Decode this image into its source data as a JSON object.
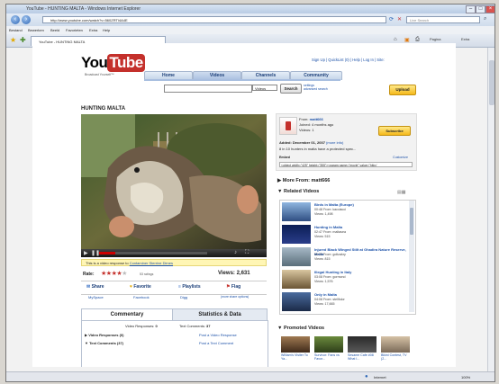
{
  "browser": {
    "title": "YouTube - HUNTING MALTA - Windows Internet Explorer",
    "url": "http://www.youtube.com/watch?v=560ZRTl4A4E",
    "search_placeholder": "Live Search",
    "menus": [
      "Bestand",
      "Bewerken",
      "Beeld",
      "Favorieten",
      "Extra",
      "Help"
    ],
    "tab_label": "YouTube - HUNTING MALTA",
    "tools": [
      "Pagina",
      "Extra"
    ],
    "status_zone": "Internet",
    "zoom": "100%"
  },
  "youtube": {
    "logo_you": "You",
    "logo_tube": "Tube",
    "tagline": "Broadcast Yourself™",
    "top_links": "Sign Up | QuickList (0) | Help | Log In | Site:",
    "nav_tabs": [
      "Home",
      "Videos",
      "Channels",
      "Community"
    ],
    "search_select": "Videos",
    "search_button": "Search",
    "search_links": [
      "settings",
      "advanced search"
    ],
    "upload_label": "Upload",
    "video_title": "HUNTING MALTA",
    "response_text": "This is a video response to",
    "response_link": "Contaminer Sterrine Dimes",
    "rate_label": "Rate:",
    "rating_stars": 3.5,
    "ratings_count": "53 ratings",
    "views_label": "Views:",
    "views_count": "2,631",
    "actions": [
      "Share",
      "Favorite",
      "Playlists",
      "Flag"
    ],
    "share_sites": [
      "MySpace",
      "Facebook",
      "Digg",
      "(more share options)"
    ],
    "comment_tabs": [
      "Commentary",
      "Statistics & Data"
    ],
    "video_responses_label": "Video Responses:",
    "video_responses_count": "0",
    "text_comments_label": "Text Comments:",
    "text_comments_count": "37",
    "resp_row_label": "Video Responses (0)",
    "resp_row_link": "Post a Video Response",
    "comm_row_label": "Text Comments (37)",
    "comm_row_link": "Post a Text Comment"
  },
  "channel": {
    "from_label": "From:",
    "from_user": "matt666",
    "joined": "Joined: 4 months ago",
    "videos": "Videos: 1",
    "subscribe": "Subscribe",
    "added": "Added: December 01, 2007",
    "more_info": "(more info)",
    "description": "8 in 10 hunters in malta have a protected spec...",
    "embed_label": "Embed",
    "customize": "Customize",
    "embed_code": "<object width=\"425\" height=\"355\"><param name=\"movie\" value=\"http:/"
  },
  "more_from": "More From: matt666",
  "related_title": "Related Videos",
  "related": [
    {
      "title": "Birds in Malta (Europe)",
      "from": "00:48 From: kacciacci",
      "views": "Views: 1,498"
    },
    {
      "title": "Hunting in Malta",
      "from": "02:47 From: maltasea",
      "views": "Views: 515"
    },
    {
      "title": "Injured Black Winged Stilt at Ghadira Nature Reserve, Malta",
      "from": "00:33 From: goltzakry",
      "views": "Views: 815"
    },
    {
      "title": "Illegal Hunting in Italy",
      "from": "03:08 From: gormond",
      "views": "Views: 1,576"
    },
    {
      "title": "Only in Malta",
      "from": "04:08 From: stellfolor",
      "views": "Views: 17,665"
    }
  ],
  "promoted_title": "Promoted Videos",
  "promoted": [
    "William's Visiter To Ya...",
    "Survivor: Fans vs Favor...",
    "Sesame Cafe #08 What I...",
    "Bikini Contest, TV (2..."
  ]
}
